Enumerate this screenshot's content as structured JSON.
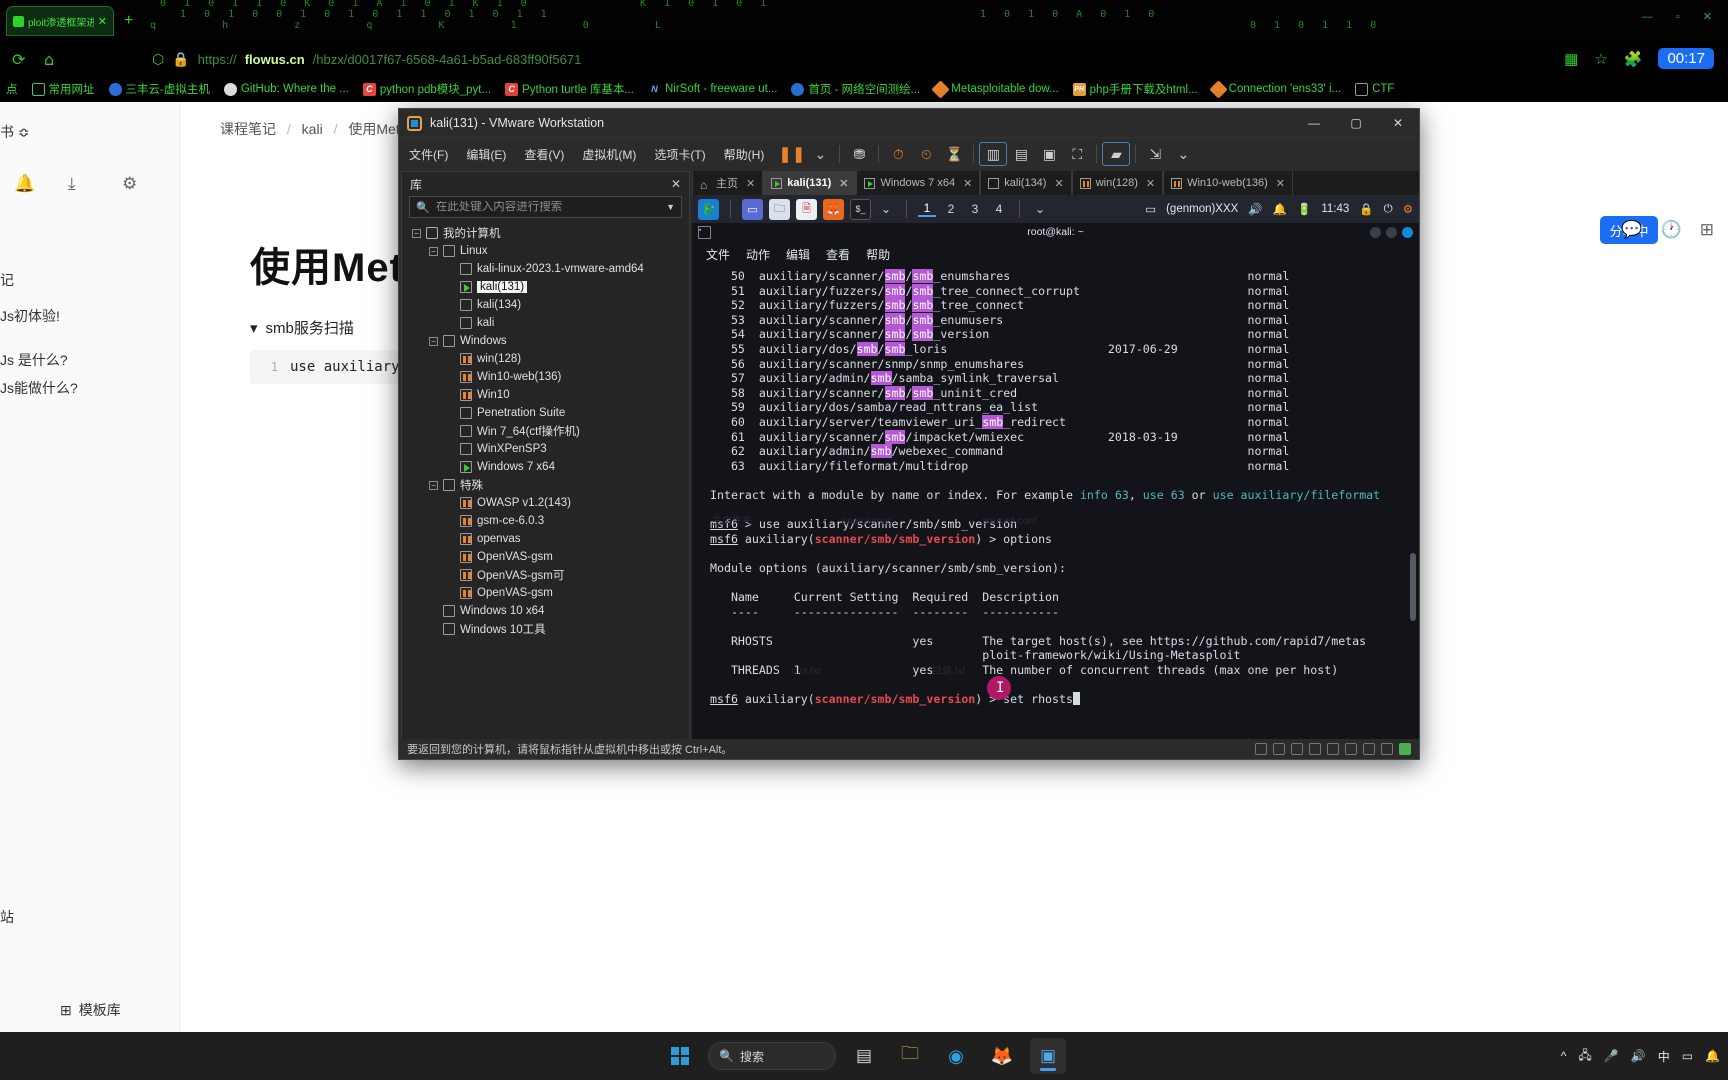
{
  "browser": {
    "tab": {
      "title": "ploit渗透框架进行b",
      "close": "✕"
    },
    "new_tab": "+",
    "window_controls": "— ▫ ✕",
    "nav": {
      "reload": "⟳",
      "home": "⌂"
    },
    "url": {
      "scheme": "https://",
      "host": "flowus.cn",
      "path": "/hbzx/d0017f67-6568-4a61-b5ad-683ff90f5671"
    },
    "clock": "00:17",
    "bookmarks": [
      {
        "label": "点",
        "icon": ""
      },
      {
        "label": "常用网址",
        "icon": "folder-icon",
        "color": ""
      },
      {
        "label": "三丰云-虚拟主机",
        "icon": "globe-icon",
        "color": "#2a6fd6"
      },
      {
        "label": "GitHub: Where the ...",
        "icon": "github-icon",
        "color": "#888888"
      },
      {
        "label": "python pdb模块_pyt...",
        "icon": "csdn-icon",
        "color": "#e8433c",
        "badge": "C"
      },
      {
        "label": "Python turtle 库基本...",
        "icon": "csdn-icon",
        "color": "#e8433c",
        "badge": "C"
      },
      {
        "label": "NirSoft - freeware ut...",
        "icon": "nirsoft-icon",
        "color": "#6fa8ff",
        "badge": "N"
      },
      {
        "label": "首页 - 网络空间测绘...",
        "icon": "fofa-icon",
        "color": "#2a6fd6"
      },
      {
        "label": "Metasploitable dow...",
        "icon": "diamond-icon",
        "color": "#e8832a"
      },
      {
        "label": "php手册下载及html...",
        "icon": "php-icon",
        "color": "#e8a33d",
        "badge": "PH"
      },
      {
        "label": "Connection 'ens33' i...",
        "icon": "link-icon",
        "color": "#e8832a"
      },
      {
        "label": "CTF",
        "icon": "ctf-icon",
        "color": "#999999"
      }
    ]
  },
  "page": {
    "rail": [
      "书 ≎",
      "🔔",
      "⤓",
      "⚙",
      "记",
      "Js初体验!",
      "Js 是什么?",
      "Js能做什么?",
      "站"
    ],
    "breadcrumb": [
      "课程笔记",
      "kali",
      "使用Metasploit"
    ],
    "breadcrumb_sep": "/",
    "title": "使用Met",
    "section_toggle": "smb服务扫描",
    "section_caret": "▾",
    "code_line_number": "1",
    "code_text": "use auxiliary/sc",
    "template_button": "模板库",
    "template_icon": "⊞",
    "share_button": "分享中",
    "top_icons": [
      "💬",
      "🕐",
      "⊞"
    ]
  },
  "vmware": {
    "title": "kali(131) - VMware Workstation",
    "window_buttons": [
      "—",
      "▢",
      "✕"
    ],
    "menu": [
      "文件(F)",
      "编辑(E)",
      "查看(V)",
      "虚拟机(M)",
      "选项卡(T)",
      "帮助(H)"
    ],
    "library": {
      "header": "库",
      "close": "✕",
      "search_placeholder": "在此处键入内容进行搜索",
      "search_value": "",
      "tree": [
        {
          "label": "我的计算机",
          "depth": 0,
          "expander": "−",
          "icon": "monitor-icon",
          "state": "none",
          "selected": false
        },
        {
          "label": "Linux",
          "depth": 1,
          "expander": "−",
          "icon": "folder-icon",
          "state": "none",
          "selected": false
        },
        {
          "label": "kali-linux-2023.1-vmware-amd64",
          "depth": 2,
          "expander": "",
          "icon": "vm-icon",
          "state": "off",
          "selected": false
        },
        {
          "label": "kali(131)",
          "depth": 2,
          "expander": "",
          "icon": "vm-icon",
          "state": "running",
          "selected": true
        },
        {
          "label": "kali(134)",
          "depth": 2,
          "expander": "",
          "icon": "vm-icon",
          "state": "off",
          "selected": false
        },
        {
          "label": "kali",
          "depth": 2,
          "expander": "",
          "icon": "vm-icon",
          "state": "off",
          "selected": false
        },
        {
          "label": "Windows",
          "depth": 1,
          "expander": "−",
          "icon": "folder-icon",
          "state": "none",
          "selected": false
        },
        {
          "label": "win(128)",
          "depth": 2,
          "expander": "",
          "icon": "vm-icon",
          "state": "paused",
          "selected": false
        },
        {
          "label": "Win10-web(136)",
          "depth": 2,
          "expander": "",
          "icon": "vm-icon",
          "state": "paused",
          "selected": false
        },
        {
          "label": "Win10",
          "depth": 2,
          "expander": "",
          "icon": "vm-icon",
          "state": "paused",
          "selected": false
        },
        {
          "label": "Penetration Suite",
          "depth": 2,
          "expander": "",
          "icon": "vm-icon",
          "state": "off",
          "selected": false
        },
        {
          "label": "Win 7_64(ctf操作机)",
          "depth": 2,
          "expander": "",
          "icon": "vm-icon",
          "state": "off",
          "selected": false
        },
        {
          "label": "WinXPenSP3",
          "depth": 2,
          "expander": "",
          "icon": "vm-icon",
          "state": "off",
          "selected": false
        },
        {
          "label": "Windows 7 x64",
          "depth": 2,
          "expander": "",
          "icon": "vm-icon",
          "state": "running",
          "selected": false
        },
        {
          "label": "特殊",
          "depth": 1,
          "expander": "−",
          "icon": "folder-icon",
          "state": "none",
          "selected": false
        },
        {
          "label": "OWASP v1.2(143)",
          "depth": 2,
          "expander": "",
          "icon": "vm-icon",
          "state": "paused",
          "selected": false
        },
        {
          "label": "gsm-ce-6.0.3",
          "depth": 2,
          "expander": "",
          "icon": "vm-icon",
          "state": "paused",
          "selected": false
        },
        {
          "label": "openvas",
          "depth": 2,
          "expander": "",
          "icon": "vm-icon",
          "state": "paused",
          "selected": false
        },
        {
          "label": "OpenVAS-gsm",
          "depth": 2,
          "expander": "",
          "icon": "vm-icon",
          "state": "paused",
          "selected": false
        },
        {
          "label": "OpenVAS-gsm可",
          "depth": 2,
          "expander": "",
          "icon": "vm-icon",
          "state": "paused",
          "selected": false
        },
        {
          "label": "OpenVAS-gsm",
          "depth": 2,
          "expander": "",
          "icon": "vm-icon",
          "state": "paused",
          "selected": false
        },
        {
          "label": "Windows 10 x64",
          "depth": 1,
          "expander": "",
          "icon": "folder-icon",
          "state": "none",
          "selected": false
        },
        {
          "label": "Windows 10工具",
          "depth": 1,
          "expander": "",
          "icon": "folder-icon",
          "state": "none",
          "selected": false
        }
      ]
    },
    "tabs": [
      {
        "label": "主页",
        "icon": "home-icon",
        "state": "none",
        "active": false,
        "close": "✕"
      },
      {
        "label": "kali(131)",
        "icon": "vm-icon",
        "state": "running",
        "active": true,
        "close": "✕"
      },
      {
        "label": "Windows 7 x64",
        "icon": "vm-icon",
        "state": "running",
        "active": false,
        "close": "✕"
      },
      {
        "label": "kali(134)",
        "icon": "vm-icon",
        "state": "off",
        "active": false,
        "close": "✕"
      },
      {
        "label": "win(128)",
        "icon": "vm-icon",
        "state": "paused",
        "active": false,
        "close": "✕"
      },
      {
        "label": "Win10-web(136)",
        "icon": "vm-icon",
        "state": "paused",
        "active": false,
        "close": "✕"
      }
    ],
    "status_bar": "要返回到您的计算机，请将鼠标指针从虚拟机中移出或按 Ctrl+Alt。"
  },
  "guest": {
    "panel": {
      "workspaces": [
        "1",
        "2",
        "3",
        "4"
      ],
      "active_workspace": "1",
      "genmon": "(genmon)XXX",
      "clock": "11:43",
      "chevron": "⌄"
    },
    "terminal": {
      "window_title": "root@kali: ~",
      "menu": [
        "文件",
        "动作",
        "编辑",
        "查看",
        "帮助"
      ],
      "modules": [
        {
          "idx": "50",
          "path": "auxiliary/scanner/smb/smb_enumshares",
          "date": "",
          "rank": "normal"
        },
        {
          "idx": "51",
          "path": "auxiliary/fuzzers/smb/smb_tree_connect_corrupt",
          "date": "",
          "rank": "normal"
        },
        {
          "idx": "52",
          "path": "auxiliary/fuzzers/smb/smb_tree_connect",
          "date": "",
          "rank": "normal"
        },
        {
          "idx": "53",
          "path": "auxiliary/scanner/smb/smb_enumusers",
          "date": "",
          "rank": "normal"
        },
        {
          "idx": "54",
          "path": "auxiliary/scanner/smb/smb_version",
          "date": "",
          "rank": "normal"
        },
        {
          "idx": "55",
          "path": "auxiliary/dos/smb/smb_loris",
          "date": "2017-06-29",
          "rank": "normal"
        },
        {
          "idx": "56",
          "path": "auxiliary/scanner/snmp/snmp_enumshares",
          "date": "",
          "rank": "normal"
        },
        {
          "idx": "57",
          "path": "auxiliary/admin/smb/samba_symlink_traversal",
          "date": "",
          "rank": "normal"
        },
        {
          "idx": "58",
          "path": "auxiliary/scanner/smb/smb_uninit_cred",
          "date": "",
          "rank": "normal"
        },
        {
          "idx": "59",
          "path": "auxiliary/dos/samba/read_nttrans_ea_list",
          "date": "",
          "rank": "normal"
        },
        {
          "idx": "60",
          "path": "auxiliary/server/teamviewer_uri_smb_redirect",
          "date": "",
          "rank": "normal"
        },
        {
          "idx": "61",
          "path": "auxiliary/scanner/smb/impacket/wmiexec",
          "date": "2018-03-19",
          "rank": "normal"
        },
        {
          "idx": "62",
          "path": "auxiliary/admin/smb/webexec_command",
          "date": "",
          "rank": "normal"
        },
        {
          "idx": "63",
          "path": "auxiliary/fileformat/multidrop",
          "date": "",
          "rank": "normal"
        }
      ],
      "hint": {
        "prefix": "Interact with a module by name or index. For example ",
        "cmd1": "info 63",
        "sep1": ", ",
        "cmd2": "use 63",
        "sep2": " or ",
        "cmd3": "use auxiliary/fileformat"
      },
      "prompt1": {
        "msf": "msf6",
        "rest": " > use auxiliary/scanner/smb/smb_version"
      },
      "prompt2": {
        "msf": "msf6",
        "pre": " auxiliary(",
        "module": "scanner/smb/smb_version",
        "post": ") > options"
      },
      "options_header": "Module options (auxiliary/scanner/smb/smb_version):",
      "table": {
        "columns": [
          "Name",
          "Current Setting",
          "Required",
          "Description"
        ],
        "rows": [
          {
            "name": "RHOSTS",
            "setting": "",
            "required": "yes",
            "description_line1": "The target host(s), see https://github.com/rapid7/metas",
            "description_line2": "ploit-framework/wiki/Using-Metasploit"
          },
          {
            "name": "THREADS",
            "setting": "1",
            "required": "yes",
            "description_line1": "The number of concurrent threads (max one per host)",
            "description_line2": ""
          }
        ]
      },
      "prompt3": {
        "msf": "msf6",
        "pre": " auxiliary(",
        "module": "scanner/smb/smb_version",
        "post": ") > set rhosts"
      },
      "watermarks": [
        "主文件夹",
        "sparta-mas...",
        "paused.conf",
        "dict.txt",
        "目录.txt"
      ]
    }
  },
  "taskbar": {
    "search_placeholder": "搜索",
    "items": [
      "start-icon",
      "search",
      "task-view-icon",
      "file-explorer-icon",
      "edge-icon",
      "firefox-icon",
      "vmware-icon"
    ],
    "tray": [
      "^",
      "🖧",
      "🎤",
      "🔊",
      "中",
      "▭",
      "🔔"
    ],
    "ime": "中"
  }
}
